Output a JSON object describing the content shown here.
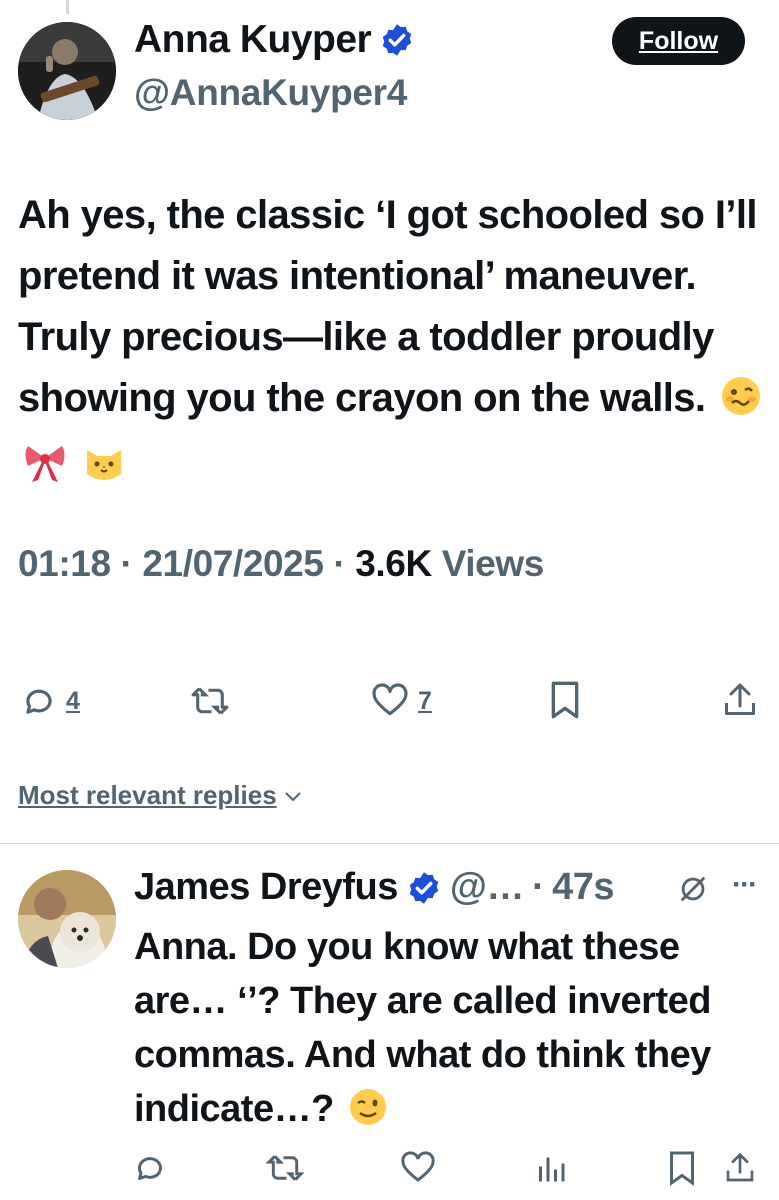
{
  "tweet": {
    "author_name": "Anna Kuyper",
    "handle": "@AnnaKuyper4",
    "follow_label": "Follow",
    "text": "Ah yes, the classic ‘I got schooled so I’ll pretend it was intentional’ maneuver. Truly precious—like a toddler proudly showing you the crayon on the walls.",
    "emojis": [
      "woozy-face",
      "ribbon",
      "cat-face"
    ],
    "time": "01:18",
    "date": "21/07/2025",
    "views_count": "3.6K",
    "views_label": "Views",
    "separator": "·",
    "actions": {
      "reply_count": "4",
      "like_count": "7"
    }
  },
  "replies_sort": {
    "label": "Most relevant replies"
  },
  "reply": {
    "author_name": "James Dreyfus",
    "handle_truncated": "@…",
    "separator": "·",
    "age": "47s",
    "more": "···",
    "text": "Anna. Do you know what these are… ‘’? They are called inverted commas. And what do think they indicate…?",
    "emoji": "winking-face"
  },
  "colors": {
    "text": "#0f1419",
    "secondary": "#536471",
    "verified": "#1d9bf0",
    "verified_gov": "#1d4ed8",
    "divider": "#cfd9de"
  }
}
